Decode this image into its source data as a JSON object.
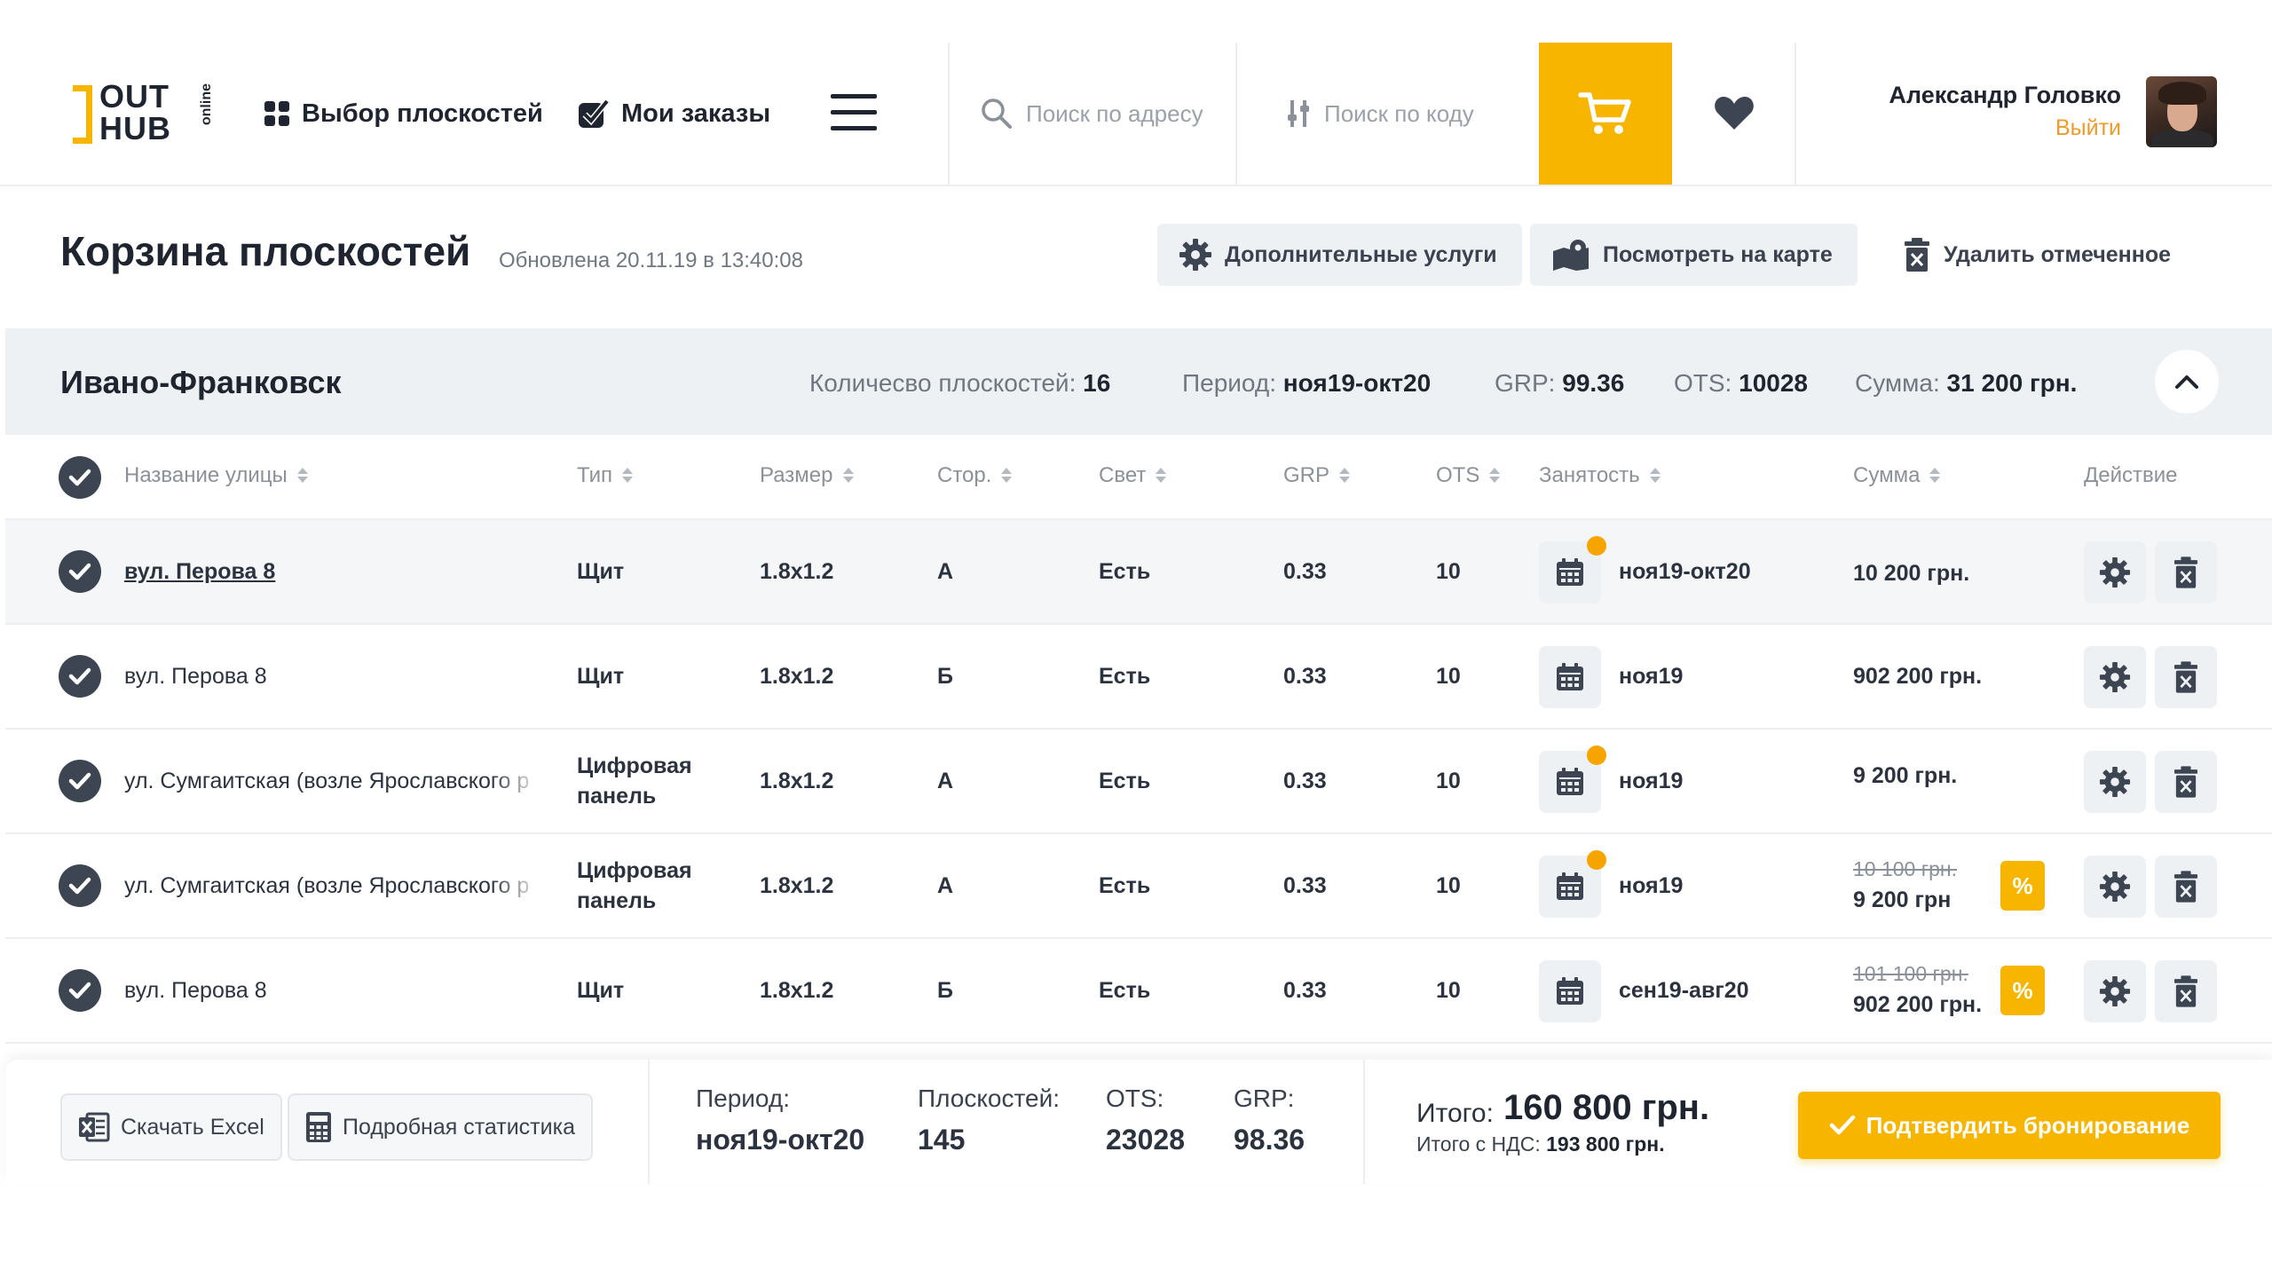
{
  "brand": {
    "logo_top": "OUT",
    "logo_bottom": "HUB",
    "logo_side": "online"
  },
  "colors": {
    "accent": "#f7b500",
    "dark": "#1f2530",
    "muted": "#8a919b",
    "panel": "#eef1f4",
    "logout": "#f09a28"
  },
  "nav": {
    "select_planes": "Выбор плоскостей",
    "my_orders": "Мои заказы"
  },
  "search": {
    "address_placeholder": "Поиск по адресу",
    "code_placeholder": "Поиск по коду"
  },
  "user": {
    "name": "Александр Головко",
    "logout": "Выйти"
  },
  "page": {
    "title": "Корзина плоскостей",
    "updated": "Обновлена 20.11.19 в 13:40:08",
    "extra_services": "Дополнительные услуги",
    "view_on_map": "Посмотреть на карте",
    "delete_selected": "Удалить отмеченное"
  },
  "city": {
    "name": "Ивано-Франковск",
    "count_label": "Количесво плоскостей:",
    "count_value": "16",
    "period_label": "Период:",
    "period_value": "ноя19-окт20",
    "grp_label": "GRP:",
    "grp_value": "99.36",
    "ots_label": "OTS:",
    "ots_value": "10028",
    "sum_label": "Сумма:",
    "sum_value": "31 200 грн."
  },
  "table": {
    "headers": {
      "street": "Название улицы",
      "type": "Тип",
      "size": "Размер",
      "side": "Стор.",
      "light": "Свет",
      "grp": "GRP",
      "ots": "OTS",
      "busy": "Занятость",
      "sum": "Сумма",
      "action": "Действие"
    },
    "rows": [
      {
        "street": "вул. Перова 8",
        "type1": "Щит",
        "type2": "",
        "size": "1.8x1.2",
        "side": "А",
        "light": "Есть",
        "grp": "0.33",
        "ots": "10",
        "busy": "ноя19-окт20",
        "price_old": "",
        "price": "10 200 грн."
      },
      {
        "street": "вул. Перова 8",
        "type1": "Щит",
        "type2": "",
        "size": "1.8x1.2",
        "side": "Б",
        "light": "Есть",
        "grp": "0.33",
        "ots": "10",
        "busy": "ноя19",
        "price_old": "",
        "price": "902 200 грн."
      },
      {
        "street": "ул. Сумгаитская (возле Ярославского р",
        "type1": "Цифровая",
        "type2": "панель",
        "size": "1.8x1.2",
        "side": "А",
        "light": "Есть",
        "grp": "0.33",
        "ots": "10",
        "busy": "ноя19",
        "price_old": "",
        "price": "9 200 грн."
      },
      {
        "street": "ул. Сумгаитская (возле Ярославского р",
        "type1": "Цифровая",
        "type2": "панель",
        "size": "1.8x1.2",
        "side": "А",
        "light": "Есть",
        "grp": "0.33",
        "ots": "10",
        "busy": "ноя19",
        "price_old": "10 100 грн.",
        "price": "9 200 грн",
        "discount": "%"
      },
      {
        "street": "вул. Перова 8",
        "type1": "Щит",
        "type2": "",
        "size": "1.8x1.2",
        "side": "Б",
        "light": "Есть",
        "grp": "0.33",
        "ots": "10",
        "busy": "сен19-авг20",
        "price_old": "101 100 грн.",
        "price": "902 200 грн.",
        "discount": "%"
      }
    ]
  },
  "footer": {
    "excel": "Скачать Excel",
    "stats": "Подробная статистика",
    "period_label": "Период:",
    "period_value": "ноя19-окт20",
    "planes_label": "Плоскостей:",
    "planes_value": "145",
    "ots_label": "OTS:",
    "ots_value": "23028",
    "grp_label": "GRP:",
    "grp_value": "98.36",
    "total_label": "Итого:",
    "total_value": "160 800 грн.",
    "vat_label": "Итого с НДС:",
    "vat_value": "193 800 грн.",
    "confirm": "Подтвердить бронирование"
  }
}
